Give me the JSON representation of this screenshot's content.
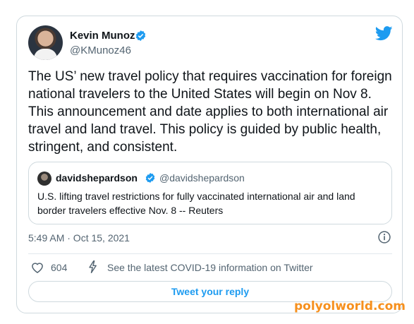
{
  "author": {
    "name": "Kevin Munoz",
    "handle": "@KMunoz46"
  },
  "tweet": {
    "text": "The US’ new travel policy that requires vaccination for foreign national travelers to the United States will begin on Nov 8. This announcement and date applies to both international air travel and land travel. This policy is guided by public health, stringent, and consistent.",
    "timestamp": "5:49 AM · Oct 15, 2021"
  },
  "quote": {
    "name": "davidshepardson",
    "handle": "@davidshepardson",
    "text": "U.S. lifting travel restrictions for fully vaccinated international air and land border travelers effective Nov. 8 -- Reuters"
  },
  "actions": {
    "like_count": "604",
    "covid_link": "See the latest COVID-19 information on Twitter",
    "reply_label": "Tweet your reply"
  },
  "watermark": "polyolworld.com",
  "icons": {
    "verified": "verified-badge-icon",
    "logo": "twitter-bird-icon",
    "info": "info-icon",
    "like": "heart-icon",
    "covid": "lightning-bolt-icon"
  },
  "colors": {
    "accent": "#1d9bf0",
    "secondary_text": "#536471",
    "border": "#cfd9de",
    "watermark": "#f6901e"
  }
}
